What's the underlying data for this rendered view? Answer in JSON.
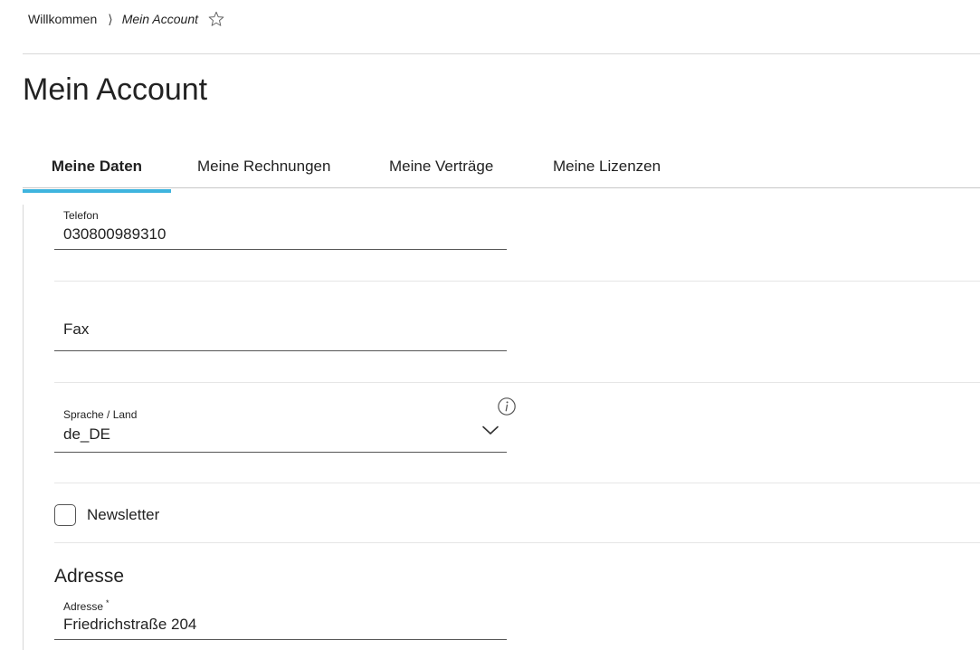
{
  "breadcrumb": {
    "home": "Willkommen",
    "separator": "⟩",
    "current": "Mein Account"
  },
  "page": {
    "title": "Mein Account"
  },
  "tabs": [
    {
      "label": "Meine Daten",
      "active": true
    },
    {
      "label": "Meine Rechnungen",
      "active": false
    },
    {
      "label": "Meine Verträge",
      "active": false
    },
    {
      "label": "Meine Lizenzen",
      "active": false
    }
  ],
  "form": {
    "telefon": {
      "label": "Telefon",
      "value": "030800989310"
    },
    "fax": {
      "placeholder": "Fax",
      "value": ""
    },
    "sprache": {
      "label": "Sprache / Land",
      "value": "de_DE"
    },
    "newsletter": {
      "label": "Newsletter",
      "checked": false
    },
    "adresse_section": "Adresse",
    "adresse": {
      "label": "Adresse",
      "required_mark": "*",
      "value": "Friedrichstraße 204"
    }
  },
  "colors": {
    "accent": "#3fb4de",
    "text": "#222222",
    "divider": "#d8d8d8"
  },
  "icons": {
    "favorite": "star-icon",
    "dropdown": "chevron-down-icon",
    "info": "info-icon"
  }
}
